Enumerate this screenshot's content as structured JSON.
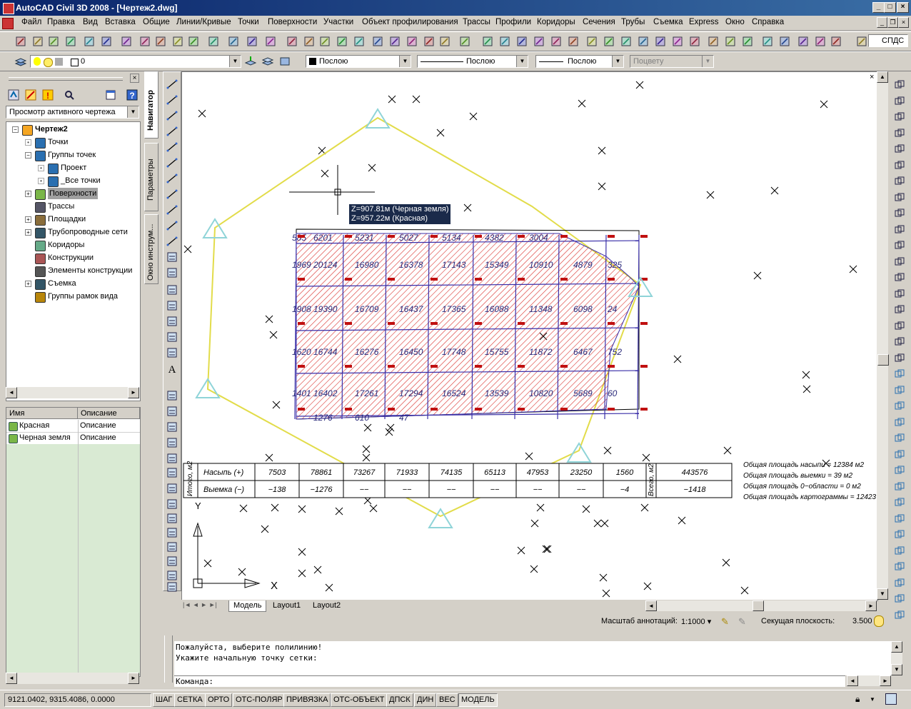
{
  "window": {
    "title": "AutoCAD Civil 3D 2008 - [Чертеж2.dwg]",
    "min": "_",
    "max": "□",
    "close": "×"
  },
  "menu": [
    "Файл",
    "Правка",
    "Вид",
    "Вставка",
    "Общие",
    "Линии/Кривые",
    "Точки",
    "Поверхности",
    "Участки",
    "Объект профилирования",
    "Трассы",
    "Профили",
    "Коридоры",
    "Сечения",
    "Трубы",
    "Съемка",
    "Express",
    "Окно",
    "Справка"
  ],
  "toolbar": {
    "style_name": "СПДС",
    "layer": "0",
    "color": "Послою",
    "linetype": "Послою",
    "lineweight": "Послою",
    "plotstyle": "Поцвету"
  },
  "prospector": {
    "view_mode": "Просмотр активного чертежа",
    "tabs": [
      "Навигатор",
      "Параметры",
      "Окно инструм..."
    ],
    "tree": [
      {
        "label": "Чертеж2",
        "level": 0,
        "expand": "−",
        "bold": true
      },
      {
        "label": "Точки",
        "level": 1,
        "expand": "·"
      },
      {
        "label": "Группы точек",
        "level": 1,
        "expand": "−"
      },
      {
        "label": "Проект",
        "level": 2,
        "expand": "·"
      },
      {
        "label": "_Все точки",
        "level": 2,
        "expand": "·"
      },
      {
        "label": "Поверхности",
        "level": 1,
        "expand": "+",
        "selected": true
      },
      {
        "label": "Трассы",
        "level": 1,
        "expand": ""
      },
      {
        "label": "Площадки",
        "level": 1,
        "expand": "+"
      },
      {
        "label": "Трубопроводные сети",
        "level": 1,
        "expand": "+"
      },
      {
        "label": "Коридоры",
        "level": 1,
        "expand": ""
      },
      {
        "label": "Конструкции",
        "level": 1,
        "expand": ""
      },
      {
        "label": "Элементы конструкции",
        "level": 1,
        "expand": ""
      },
      {
        "label": "Съемка",
        "level": 1,
        "expand": "+"
      },
      {
        "label": "Группы рамок вида",
        "level": 1,
        "expand": ""
      }
    ],
    "list_headers": [
      "Имя",
      "Описание"
    ],
    "list_rows": [
      {
        "name": "Красная",
        "desc": "Описание"
      },
      {
        "name": "Черная земля",
        "desc": "Описание"
      }
    ]
  },
  "drawing": {
    "tooltip": [
      "Z=907.81м (Черная земля)",
      "Z=957.22м (Красная)"
    ],
    "grid_values": [
      [
        "585",
        "6201",
        "5231",
        "5027",
        "5134",
        "4382",
        "3004",
        "",
        ""
      ],
      [
        "1969",
        "20124",
        "16980",
        "16378",
        "17143",
        "15349",
        "10910",
        "4879",
        "325"
      ],
      [
        "1908",
        "19390",
        "16709",
        "16437",
        "17365",
        "16088",
        "11348",
        "6098",
        "24"
      ],
      [
        "1620",
        "16744",
        "16276",
        "16450",
        "17748",
        "15755",
        "11872",
        "6467",
        "752"
      ],
      [
        "1401",
        "16402",
        "17261",
        "17294",
        "16524",
        "13539",
        "10820",
        "5689",
        "60"
      ],
      [
        "",
        "1276",
        "610",
        "47",
        "",
        "",
        "",
        "",
        ""
      ]
    ],
    "summary_table": {
      "row_header_left": "Итого, м2",
      "row_header_right": "Всего, м2",
      "fill_label": "Насыпь (+)",
      "cut_label": "Выемка (−)",
      "fill": [
        "7503",
        "78861",
        "73267",
        "71933",
        "74135",
        "65113",
        "47953",
        "23250",
        "1560"
      ],
      "cut": [
        "−138",
        "−1276",
        "−−",
        "−−",
        "−−",
        "−−",
        "−−",
        "−−",
        "−4"
      ],
      "fill_total": "443576",
      "cut_total": "−1418"
    },
    "notes": [
      "Общая площадь насыпи = 12384 м2",
      "Общая площадь выемки = 39 м2",
      "Общая площадь 0−области = 0 м2",
      "Общая площадь картограммы = 12423"
    ],
    "ucs_y": "Y",
    "ucs_x": "X"
  },
  "layout_tabs": [
    "Модель",
    "Layout1",
    "Layout2"
  ],
  "annotation": {
    "scale_label": "Масштаб аннотаций:",
    "scale_value": "1:1000 ▾",
    "section_label": "Секущая плоскость:",
    "section_value": "3.500"
  },
  "command": {
    "history": [
      "Пожалуйста, выберите полилинию!",
      "Укажите начальную точку сетки:"
    ],
    "prompt": "Команда:"
  },
  "status": {
    "coords": "9121.0402, 9315.4086, 0.0000",
    "buttons": [
      "ШАГ",
      "СЕТКА",
      "ОРТО",
      "ОТС-ПОЛЯР",
      "ПРИВЯЗКА",
      "ОТС-ОБЪЕКТ",
      "ДПСК",
      "ДИН",
      "ВЕС",
      "МОДЕЛЬ"
    ]
  },
  "colors": {
    "hatch": "#d9302c",
    "grid": "#3a2fa8",
    "boundary": "#e2dc4a",
    "station": "#8fd4d8"
  }
}
